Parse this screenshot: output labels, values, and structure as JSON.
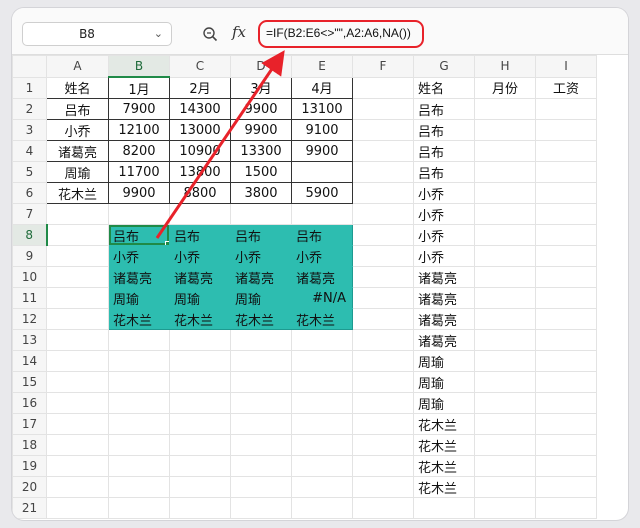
{
  "namebox": {
    "value": "B8"
  },
  "formula": {
    "fx": "fx",
    "text": "=IF(B2:E6<>\"\",A2:A6,NA())"
  },
  "columns": [
    "A",
    "B",
    "C",
    "D",
    "E",
    "F",
    "G",
    "H",
    "I"
  ],
  "rows": [
    "1",
    "2",
    "3",
    "4",
    "5",
    "6",
    "7",
    "8",
    "9",
    "10",
    "11",
    "12",
    "13",
    "14",
    "15",
    "16",
    "17",
    "18",
    "19",
    "20",
    "21"
  ],
  "cells": {
    "A1": "姓名",
    "B1": "1月",
    "C1": "2月",
    "D1": "3月",
    "E1": "4月",
    "A2": "吕布",
    "B2": "7900",
    "C2": "14300",
    "D2": "9900",
    "E2": "13100",
    "A3": "小乔",
    "B3": "12100",
    "C3": "13000",
    "D3": "9900",
    "E3": "9100",
    "A4": "诸葛亮",
    "B4": "8200",
    "C4": "10900",
    "D4": "13300",
    "E4": "9900",
    "A5": "周瑜",
    "B5": "11700",
    "C5": "13800",
    "D5": "1500",
    "E5": "",
    "A6": "花木兰",
    "B6": "9900",
    "C6": "8800",
    "D6": "3800",
    "E6": "5900",
    "B8": "吕布",
    "C8": "吕布",
    "D8": "吕布",
    "E8": "吕布",
    "B9": "小乔",
    "C9": "小乔",
    "D9": "小乔",
    "E9": "小乔",
    "B10": "诸葛亮",
    "C10": "诸葛亮",
    "D10": "诸葛亮",
    "E10": "诸葛亮",
    "B11": "周瑜",
    "C11": "周瑜",
    "D11": "周瑜",
    "E11": "#N/A",
    "B12": "花木兰",
    "C12": "花木兰",
    "D12": "花木兰",
    "E12": "花木兰",
    "G1": "姓名",
    "H1": "月份",
    "I1": "工资",
    "G2": "吕布",
    "G3": "吕布",
    "G4": "吕布",
    "G5": "吕布",
    "G6": "小乔",
    "G7": "小乔",
    "G8": "小乔",
    "G9": "小乔",
    "G10": "诸葛亮",
    "G11": "诸葛亮",
    "G12": "诸葛亮",
    "G13": "诸葛亮",
    "G14": "周瑜",
    "G15": "周瑜",
    "G16": "周瑜",
    "G17": "花木兰",
    "G18": "花木兰",
    "G19": "花木兰",
    "G20": "花木兰"
  },
  "colors": {
    "highlight": "#2dbdb0",
    "accent": "#e8222a",
    "selection": "#1f8a47"
  },
  "icons": {
    "zoom": "magnifier-icon",
    "fx": "fx-icon",
    "dropdown": "chevron-down-icon"
  }
}
